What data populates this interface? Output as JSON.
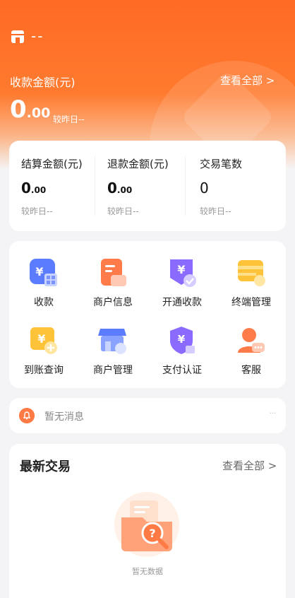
{
  "header": {
    "store_name": "--",
    "amount_title": "收款金额(元)",
    "view_all": "查看全部 >",
    "amount_int": "0",
    "amount_dec": ".00",
    "compare": "较昨日--",
    "color": "#ff6a24"
  },
  "stats": [
    {
      "label": "结算金额(元)",
      "int": "0",
      "dec": ".00",
      "compare": "较昨日--"
    },
    {
      "label": "退款金额(元)",
      "int": "0",
      "dec": ".00",
      "compare": "较昨日--"
    },
    {
      "label": "交易笔数",
      "int": "0",
      "dec": "",
      "compare": "较昨日--"
    }
  ],
  "menu": [
    {
      "label": "收款",
      "icon": "collect-qr-icon"
    },
    {
      "label": "商户信息",
      "icon": "merchant-info-icon"
    },
    {
      "label": "开通收款",
      "icon": "activate-payment-icon"
    },
    {
      "label": "终端管理",
      "icon": "terminal-management-icon"
    },
    {
      "label": "到账查询",
      "icon": "arrival-query-icon"
    },
    {
      "label": "商户管理",
      "icon": "merchant-management-icon"
    },
    {
      "label": "支付认证",
      "icon": "payment-auth-icon"
    },
    {
      "label": "客服",
      "icon": "customer-service-icon"
    }
  ],
  "notice": {
    "text": "暂无消息",
    "more": "···"
  },
  "latest": {
    "title": "最新交易",
    "view_all": "查看全部 >",
    "empty_text": "暂无数据"
  }
}
